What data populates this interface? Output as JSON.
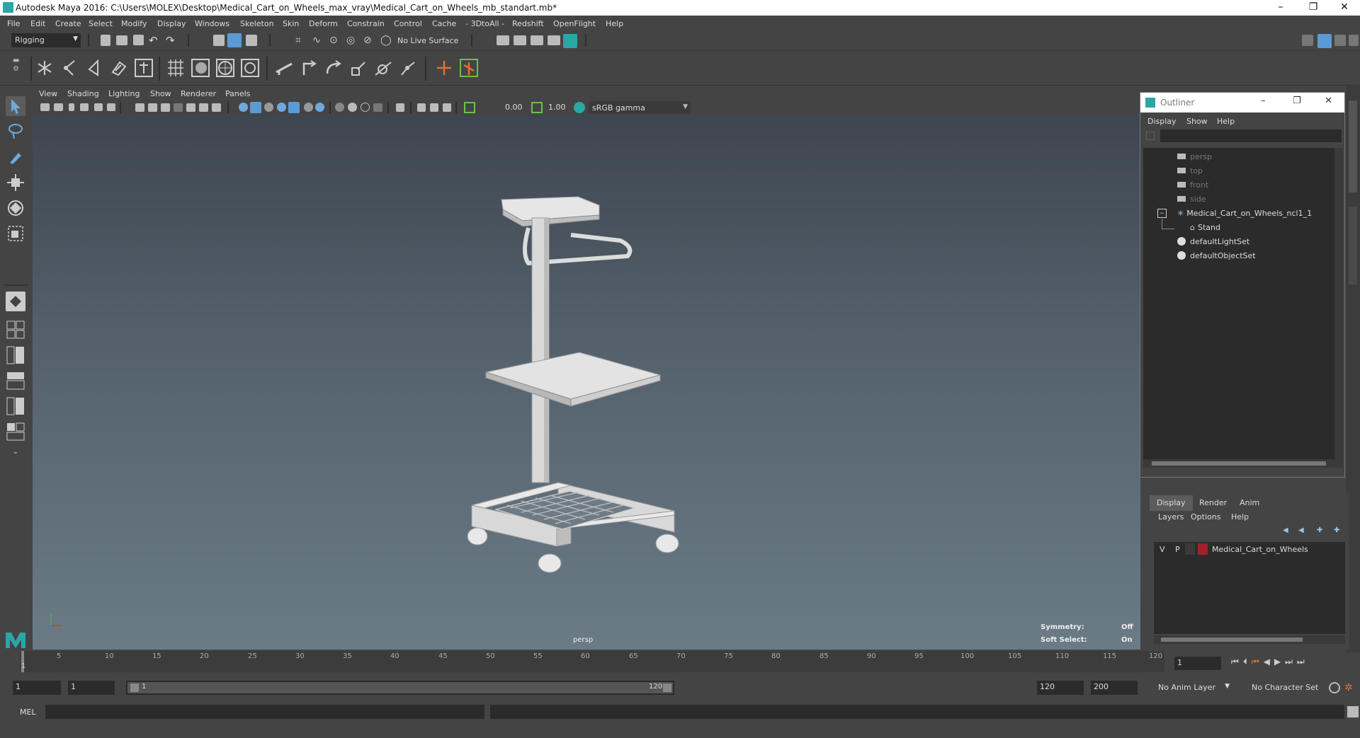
{
  "window": {
    "title": "Autodesk Maya 2016: C:\\Users\\MOLEX\\Desktop\\Medical_Cart_on_Wheels_max_vray\\Medical_Cart_on_Wheels_mb_standart.mb*",
    "minimize": "–",
    "restore": "❐",
    "close": "✕"
  },
  "menubar": [
    "File",
    "Edit",
    "Create",
    "Select",
    "Modify",
    "Display",
    "Windows",
    "Skeleton",
    "Skin",
    "Deform",
    "Constrain",
    "Control",
    "Cache",
    "- 3DtoAll -",
    "Redshift",
    "OpenFlight",
    "Help"
  ],
  "statusline": {
    "menuset": "Rigging",
    "live_surface": "No Live Surface"
  },
  "panel": {
    "menus": [
      "View",
      "Shading",
      "Lighting",
      "Show",
      "Renderer",
      "Panels"
    ],
    "near_value": "0.00",
    "far_value": "1.00",
    "color_space": "sRGB gamma",
    "camera_label": "persp",
    "symmetry_label": "Symmetry:",
    "symmetry_value": "Off",
    "soft_select_label": "Soft Select:",
    "soft_select_value": "On"
  },
  "outliner": {
    "title": "Outliner",
    "menus": [
      "Display",
      "Show",
      "Help"
    ],
    "items": [
      {
        "label": "persp",
        "icon": "camera-icon",
        "dim": true
      },
      {
        "label": "top",
        "icon": "camera-icon",
        "dim": true
      },
      {
        "label": "front",
        "icon": "camera-icon",
        "dim": true
      },
      {
        "label": "side",
        "icon": "camera-icon",
        "dim": true
      },
      {
        "label": "Medical_Cart_on_Wheels_ncl1_1",
        "icon": "group-icon",
        "dim": false
      },
      {
        "label": "Stand",
        "icon": "mesh-icon",
        "dim": false
      },
      {
        "label": "defaultLightSet",
        "icon": "set-icon",
        "dim": false
      },
      {
        "label": "defaultObjectSet",
        "icon": "set-icon",
        "dim": false
      }
    ]
  },
  "layer_editor": {
    "tabs": [
      "Display",
      "Render",
      "Anim"
    ],
    "menus": [
      "Layers",
      "Options",
      "Help"
    ],
    "layer": {
      "v": "V",
      "p": "P",
      "name": "Medical_Cart_on_Wheels",
      "color": "#a3202a"
    }
  },
  "timeline": {
    "ticks": [
      "1",
      "5",
      "10",
      "15",
      "20",
      "25",
      "30",
      "35",
      "40",
      "45",
      "50",
      "55",
      "60",
      "65",
      "70",
      "75",
      "80",
      "85",
      "90",
      "95",
      "100",
      "105",
      "110",
      "115",
      "120"
    ],
    "current_frame": "1"
  },
  "range": {
    "start": "1",
    "anim_start": "1",
    "slider_start": "1",
    "slider_end": "120",
    "end": "120",
    "anim_end": "200",
    "anim_layer": "No Anim Layer",
    "character_set": "No Character Set"
  },
  "cmdline": {
    "label": "MEL"
  },
  "colors": {
    "accent": "#2aa6a6",
    "active_icon": "#5b9bd5",
    "viewport_top": "#3e4650",
    "viewport_bottom": "#6a7b86"
  }
}
